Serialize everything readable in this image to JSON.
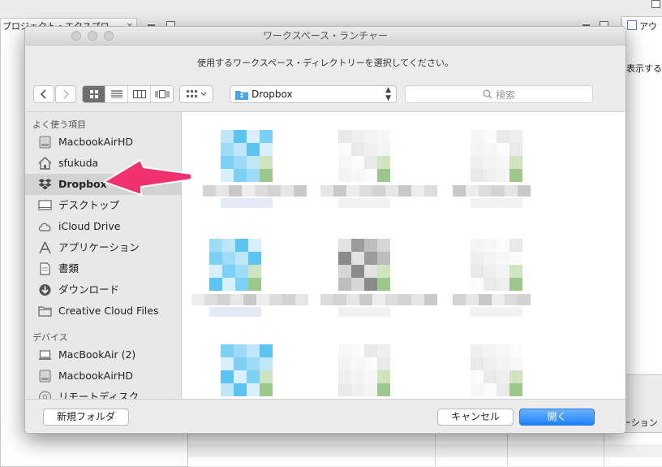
{
  "background": {
    "project_tab_label": "プロジェクト・エクスプロ",
    "right_tab_label": "アウ",
    "right_panel_text": "表示する",
    "location_header": "ロケーション"
  },
  "dialog": {
    "title": "ワークスペース・ランチャー",
    "message": "使用するワークスペース・ディレクトリーを選択してください。",
    "location": "Dropbox",
    "search_placeholder": "検索",
    "sidebar": {
      "favorites_heading": "よく使う項目",
      "devices_heading": "デバイス",
      "favorites": [
        {
          "label": "MacbookAirHD",
          "icon": "hard-drive-icon"
        },
        {
          "label": "sfukuda",
          "icon": "home-icon"
        },
        {
          "label": "Dropbox",
          "icon": "dropbox-icon",
          "selected": true
        },
        {
          "label": "デスクトップ",
          "icon": "desktop-icon"
        },
        {
          "label": "iCloud Drive",
          "icon": "cloud-icon"
        },
        {
          "label": "アプリケーション",
          "icon": "applications-icon"
        },
        {
          "label": "書類",
          "icon": "documents-icon"
        },
        {
          "label": "ダウンロード",
          "icon": "download-icon"
        },
        {
          "label": "Creative Cloud Files",
          "icon": "folder-icon"
        }
      ],
      "devices": [
        {
          "label": "MacBookAir (2)",
          "icon": "laptop-icon"
        },
        {
          "label": "MacbookAirHD",
          "icon": "hard-drive-icon"
        },
        {
          "label": "リモートディスク",
          "icon": "disc-icon"
        }
      ]
    },
    "new_folder_label": "新規フォルダ",
    "cancel_label": "キャンセル",
    "open_label": "開く",
    "colors": {
      "accent_blue": "#1a82fb",
      "arrow_pink": "#f0336f",
      "selection": "#d3d3d3"
    }
  }
}
